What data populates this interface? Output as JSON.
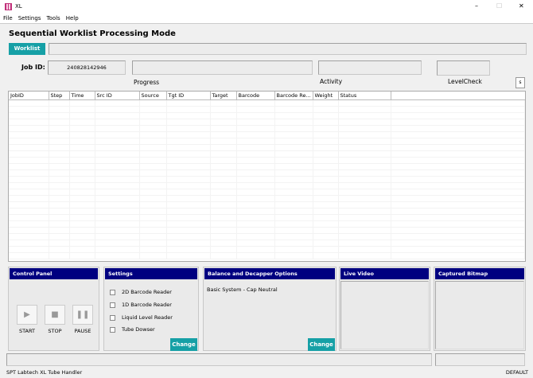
{
  "window": {
    "title": "XL",
    "min": "–",
    "max": "☐",
    "close": "✕"
  },
  "menu": [
    "File",
    "Settings",
    "Tools",
    "Help"
  ],
  "header": {
    "title": "Sequential Worklist Processing Mode",
    "worklist_tab": "Worklist"
  },
  "job": {
    "label": "Job ID:",
    "value": "240828142946",
    "progress_label": "Progress",
    "activity_label": "Activity",
    "levelcheck_label": "LevelCheck",
    "s_button": "s"
  },
  "table": {
    "columns": [
      "JobID",
      "Step",
      "Time",
      "Src ID",
      "Source",
      "Tgt ID",
      "Target",
      "Barcode",
      "Barcode Re...",
      "Weight",
      "Status",
      ""
    ],
    "rows": []
  },
  "control_panel": {
    "title": "Control Panel",
    "start": "START",
    "stop": "STOP",
    "pause": "PAUSE"
  },
  "settings": {
    "title": "Settings",
    "options": [
      {
        "label": "2D Barcode Reader",
        "checked": false
      },
      {
        "label": "1D Barcode Reader",
        "checked": false
      },
      {
        "label": "Liquid Level Reader",
        "checked": false
      },
      {
        "label": "Tube Dowser",
        "checked": false
      }
    ],
    "change": "Change"
  },
  "balance": {
    "title": "Balance and Decapper Options",
    "value": "Basic System - Cap Neutral",
    "change": "Change"
  },
  "live_video": {
    "title": "Live Video"
  },
  "captured_bitmap": {
    "title": "Captured Bitmap"
  },
  "status": {
    "left": "SPT Labtech XL Tube Handler",
    "right": "DEFAULT"
  }
}
